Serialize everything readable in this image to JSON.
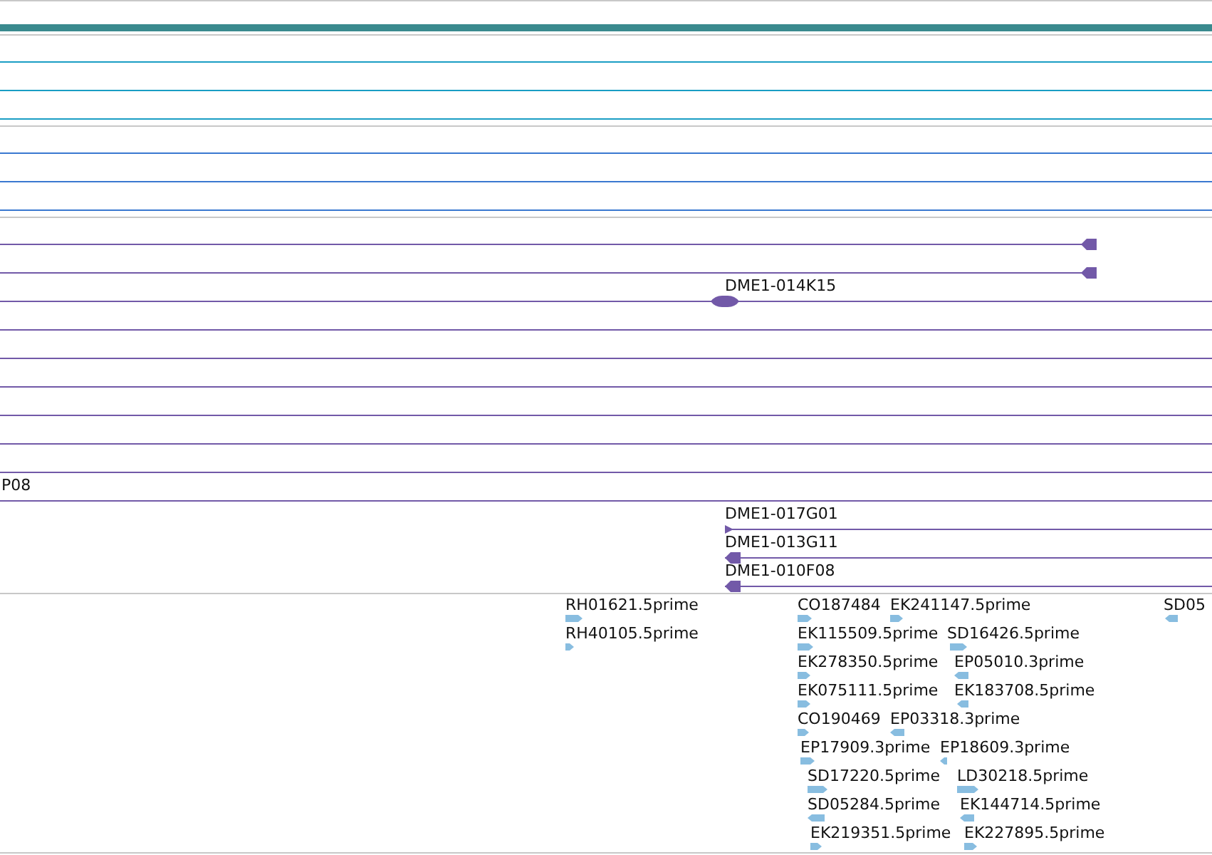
{
  "tracks": [
    {
      "kind": "band",
      "color": "#3a8a8e"
    },
    {
      "kind": "lines",
      "color": "#1a9ec4",
      "rows": [
        {
          "kind": "line"
        },
        {
          "kind": "line"
        },
        {
          "kind": "line"
        }
      ]
    },
    {
      "kind": "lines",
      "color": "#3a78d0",
      "rows": [
        {
          "kind": "line"
        },
        {
          "kind": "line"
        },
        {
          "kind": "line"
        }
      ]
    },
    {
      "kind": "lines",
      "color": "#7259a8",
      "rows": [
        {
          "kind": "stub"
        },
        {
          "kind": "stub"
        },
        {
          "kind": "clone",
          "label": "DME1-014K15"
        },
        {
          "kind": "line"
        },
        {
          "kind": "line"
        },
        {
          "kind": "line"
        },
        {
          "kind": "line"
        },
        {
          "kind": "line"
        },
        {
          "kind": "line"
        },
        {
          "kind": "line",
          "label": "P08"
        },
        {
          "kind": "forward",
          "label": "DME1-017G01"
        },
        {
          "kind": "reverse",
          "label": "DME1-013G11"
        },
        {
          "kind": "reverse",
          "label": "DME1-010F08"
        }
      ]
    },
    {
      "kind": "reads",
      "color": "#88bde0",
      "rows": [
        {
          "items": [
            {
              "label": "RH01621.5prime",
              "reverse": false
            },
            {
              "label": "CO187484",
              "reverse": false
            },
            {
              "label": "EK241147.5prime",
              "reverse": false
            },
            {
              "label": "SD05",
              "reverse": true
            }
          ]
        },
        {
          "items": [
            {
              "label": "RH40105.5prime",
              "reverse": false
            },
            {
              "label": "EK115509.5prime",
              "reverse": false
            },
            {
              "label": "SD16426.5prime",
              "reverse": false
            }
          ]
        },
        {
          "items": [
            {
              "label": "EK278350.5prime",
              "reverse": false
            },
            {
              "label": "EP05010.3prime",
              "reverse": true
            }
          ]
        },
        {
          "items": [
            {
              "label": "EK075111.5prime",
              "reverse": false
            },
            {
              "label": "EK183708.5prime",
              "reverse": true
            }
          ]
        },
        {
          "items": [
            {
              "label": "CO190469",
              "reverse": false
            },
            {
              "label": "EP03318.3prime",
              "reverse": true
            }
          ]
        },
        {
          "items": [
            {
              "label": "EP17909.3prime",
              "reverse": false
            },
            {
              "label": "EP18609.3prime",
              "reverse": true
            }
          ]
        },
        {
          "items": [
            {
              "label": "SD17220.5prime",
              "reverse": false
            },
            {
              "label": "LD30218.5prime",
              "reverse": false
            }
          ]
        },
        {
          "items": [
            {
              "label": "SD05284.5prime",
              "reverse": true
            },
            {
              "label": "EK144714.5prime",
              "reverse": true
            }
          ]
        },
        {
          "items": [
            {
              "label": "EK219351.5prime",
              "reverse": false
            },
            {
              "label": "EK227895.5prime",
              "reverse": false
            }
          ]
        }
      ]
    }
  ]
}
